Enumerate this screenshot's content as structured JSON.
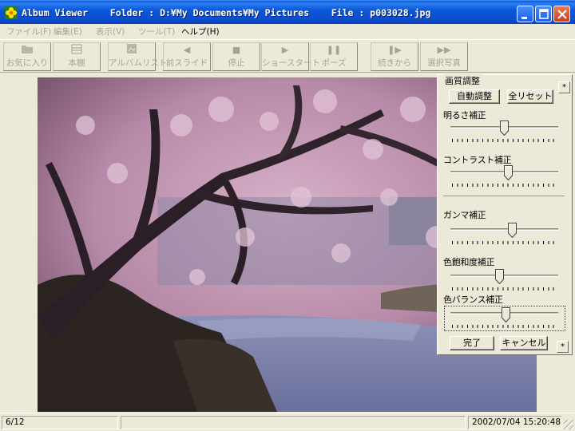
{
  "window": {
    "title": "Album Viewer    Folder : D:¥My Documents¥My Pictures    File : p003028.jpg",
    "icons": [
      "app-flower-icon",
      "minimize-icon",
      "maximize-icon",
      "close-icon"
    ]
  },
  "menu": [
    {
      "label": "ファイル(F)",
      "enabled": false
    },
    {
      "label": "編集(E)",
      "enabled": false
    },
    {
      "label": "表示(V)",
      "enabled": false
    },
    {
      "label": "ツール(T)",
      "enabled": false
    },
    {
      "label": "ヘルプ(H)",
      "enabled": true
    }
  ],
  "toolbar": [
    {
      "label": "お気に入り",
      "icon": "folder-icon"
    },
    {
      "label": "本棚",
      "icon": "bookshelf-icon"
    },
    {
      "label": "アルバムリスト",
      "icon": "album-list-icon"
    },
    {
      "label": "前スライド",
      "icon": "prev-icon"
    },
    {
      "label": "停止",
      "icon": "stop-icon"
    },
    {
      "label": "ショースタート",
      "icon": "play-icon"
    },
    {
      "label": "ポーズ",
      "icon": "pause-icon"
    },
    {
      "label": "続きから",
      "icon": "resume-icon"
    },
    {
      "label": "選択写真",
      "icon": "skip-icon"
    }
  ],
  "panel": {
    "title": "画質調整",
    "auto_button": "自動調整",
    "reset_button": "全リセット",
    "done_button": "完了",
    "cancel_button": "キャンセル",
    "pin_label": "*",
    "sliders": [
      {
        "label": "明るさ補正",
        "value": 0.5
      },
      {
        "label": "コントラスト補正",
        "value": 0.54
      },
      {
        "label": "ガンマ補正",
        "value": 0.58
      },
      {
        "label": "色飽和度補正",
        "value": 0.45
      },
      {
        "label": "色バランス補正",
        "value": 0.52
      }
    ]
  },
  "status": {
    "position": "6/12",
    "middle": "",
    "datetime": "2002/07/04 15:20:48"
  },
  "colors": {
    "titlebar": "#0a5ce6",
    "face": "#ece9d8",
    "disabled_text": "#a6a392",
    "blossom": "#c89ab8"
  }
}
